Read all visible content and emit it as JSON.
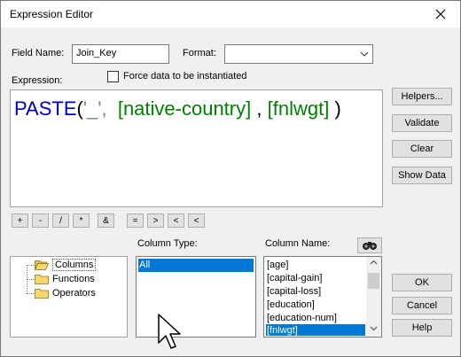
{
  "window": {
    "title": "Expression Editor"
  },
  "field_name": {
    "label": "Field Name:",
    "value": "Join_Key"
  },
  "format": {
    "label": "Format:",
    "value": ""
  },
  "expression": {
    "label": "Expression:",
    "func": "PASTE",
    "open_paren": "(",
    "string_literal": "'_',",
    "col1": "[native-country]",
    "comma": ",",
    "col2": "[fnlwgt]",
    "close_paren": ")"
  },
  "force_checkbox": {
    "label": "Force data to be instantiated",
    "checked": false
  },
  "side_buttons": {
    "helpers": "Helpers...",
    "validate": "Validate",
    "clear": "Clear",
    "show_data": "Show Data"
  },
  "operators": [
    "+",
    "-",
    "/",
    "*",
    "&",
    "=",
    ">",
    "<",
    "<"
  ],
  "tree": {
    "items": [
      "Columns",
      "Functions",
      "Operators"
    ],
    "selected": "Columns"
  },
  "column_type": {
    "label": "Column Type:",
    "items": [
      "All"
    ],
    "selected": "All"
  },
  "column_name": {
    "label": "Column Name:",
    "items": [
      "[age]",
      "[capital-gain]",
      "[capital-loss]",
      "[education]",
      "[education-num]",
      "[fnlwgt]"
    ],
    "selected": "[fnlwgt]"
  },
  "dialog_buttons": {
    "ok": "OK",
    "cancel": "Cancel",
    "help": "Help"
  },
  "colors": {
    "function": "#0000c0",
    "column": "#008000",
    "string": "#808080",
    "selection": "#0078d7"
  }
}
